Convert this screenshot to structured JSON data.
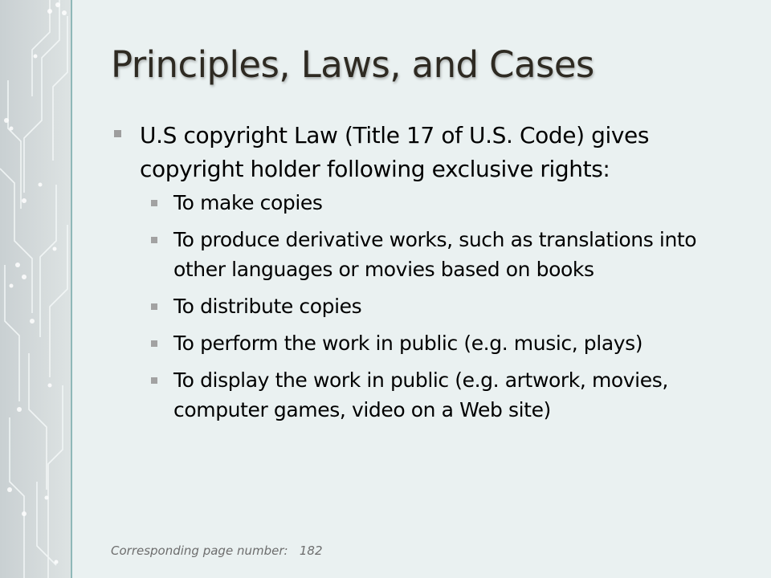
{
  "slide": {
    "title": "Principles, Laws, and Cases",
    "main_bullet": "U.S copyright Law (Title 17 of U.S. Code) gives copyright holder following exclusive rights:",
    "sub_bullets": [
      "To make copies",
      "To produce derivative works, such as translations into other languages or movies based on books",
      "To distribute copies",
      "To perform the work in public (e.g. music, plays)",
      "To display the work in public (e.g. artwork, movies, computer games, video on a Web site)"
    ],
    "footer": "Corresponding page number:   182"
  },
  "colors": {
    "background": "#eaf1f1",
    "sidebar_accent": "#8fb8b8",
    "title_text": "#2e2a22",
    "bullet_marker": "#9e9e9e",
    "footer_text": "#6d6d6d"
  },
  "icons": {
    "bullet": "square-bullet-icon",
    "sidebar": "circuit-board-pattern"
  }
}
